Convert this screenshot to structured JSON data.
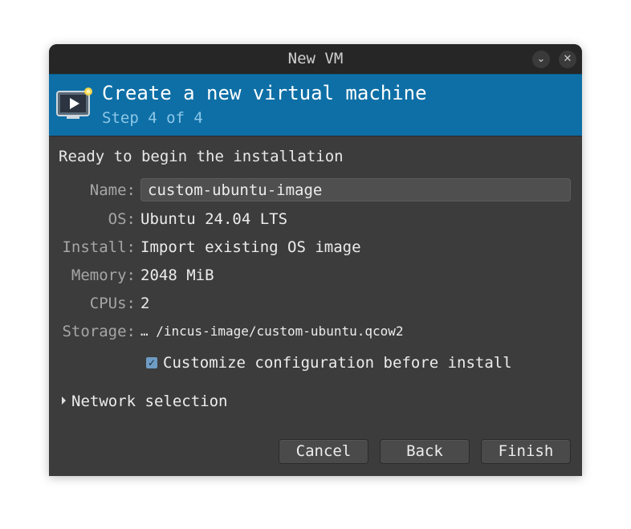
{
  "window": {
    "title": "New VM"
  },
  "banner": {
    "title": "Create a new virtual machine",
    "subtitle": "Step 4 of 4"
  },
  "summary": {
    "heading": "Ready to begin the installation",
    "name_label": "Name:",
    "name_value": "custom-ubuntu-image",
    "os_label": "OS:",
    "os_value": "Ubuntu 24.04 LTS",
    "install_label": "Install:",
    "install_value": "Import existing OS image",
    "memory_label": "Memory:",
    "memory_value": "2048 MiB",
    "cpus_label": "CPUs:",
    "cpus_value": "2",
    "storage_label": "Storage:",
    "storage_value": "… /incus-image/custom-ubuntu.qcow2"
  },
  "customize": {
    "label": "Customize configuration before install",
    "checked": true
  },
  "network": {
    "label": "Network selection",
    "expanded": false
  },
  "buttons": {
    "cancel": "Cancel",
    "back": "Back",
    "finish": "Finish"
  },
  "icons": {
    "minimize": "chevron-down-icon",
    "close": "close-icon",
    "banner": "vm-monitor-icon",
    "check": "checkmark-icon",
    "expander": "triangle-right-icon"
  },
  "colors": {
    "banner_bg": "#0e6fa6",
    "window_bg": "#3c3c3c",
    "titlebar_bg": "#262626",
    "accent": "#6e9cc4"
  }
}
